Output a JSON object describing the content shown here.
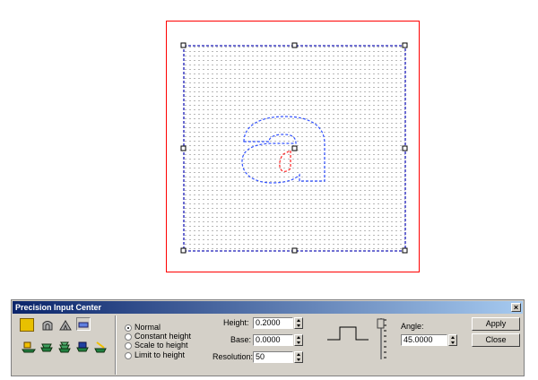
{
  "panel": {
    "title": "Precision Input Center",
    "close_glyph": "×"
  },
  "options": {
    "items": [
      "Normal",
      "Constant height",
      "Scale to height",
      "Limit to height"
    ],
    "selected": "Normal"
  },
  "fields": {
    "height_label": "Height:",
    "height_value": "0.2000",
    "base_label": "Base:",
    "base_value": "0.0000",
    "resolution_label": "Resolution:",
    "resolution_value": "50",
    "angle_label": "Angle:",
    "angle_value": "45.0000"
  },
  "buttons": {
    "apply": "Apply",
    "close": "Close"
  },
  "colors": {
    "accent": "#e8c000",
    "selection_dashes": "#2020c0",
    "outline_red": "#ff0000",
    "glyph_blue": "#3050ff"
  }
}
